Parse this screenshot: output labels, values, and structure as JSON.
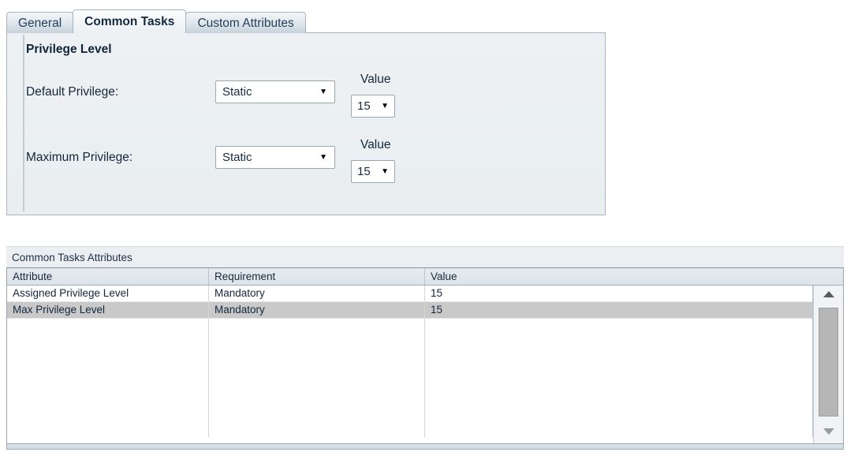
{
  "tabs": [
    {
      "label": "General",
      "active": false
    },
    {
      "label": "Common Tasks",
      "active": true
    },
    {
      "label": "Custom Attributes",
      "active": false
    }
  ],
  "panel": {
    "section_title": "Privilege Level",
    "value_caption": "Value",
    "rows": [
      {
        "label": "Default Privilege:",
        "mode": "Static",
        "value": "15",
        "caption": "Value"
      },
      {
        "label": "Maximum Privilege:",
        "mode": "Static",
        "value": "15",
        "caption": "Value"
      }
    ],
    "caret_glyph": "▼"
  },
  "attributes": {
    "caption": "Common Tasks Attributes",
    "columns": [
      "Attribute",
      "Requirement",
      "Value"
    ],
    "rows": [
      {
        "attribute": "Assigned Privilege Level",
        "requirement": "Mandatory",
        "value": "15",
        "selected": false
      },
      {
        "attribute": "Max Privilege Level",
        "requirement": "Mandatory",
        "value": "15",
        "selected": true
      }
    ],
    "scrollbar": {
      "up": "scroll-up",
      "down": "scroll-down"
    }
  },
  "colors": {
    "panel_bg": "#eceff1",
    "tab_border": "#a8b5c0",
    "selected_row": "#c9c9c9",
    "text": "#16293d"
  }
}
